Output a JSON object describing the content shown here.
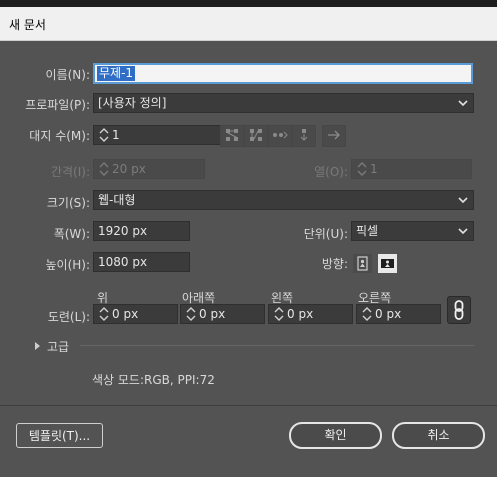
{
  "window": {
    "title": "새 문서"
  },
  "form": {
    "name": {
      "label": "이름(N):",
      "value": "무제-1"
    },
    "profile": {
      "label": "프로파일(P):",
      "value": "[사용자 정의]"
    },
    "artboards": {
      "label": "대지 수(M):",
      "value": "1"
    },
    "spacing": {
      "label": "간격(I):",
      "value": "20 px"
    },
    "columns": {
      "label": "열(O):",
      "value": "1"
    },
    "size": {
      "label": "크기(S):",
      "value": "웹-대형"
    },
    "width": {
      "label": "폭(W):",
      "value": "1920 px"
    },
    "units": {
      "label": "단위(U):",
      "value": "픽셀"
    },
    "height": {
      "label": "높이(H):",
      "value": "1080 px"
    },
    "orientation": {
      "label": "방향:"
    },
    "bleed": {
      "label": "도련(L):",
      "top_label": "위",
      "top_value": "0 px",
      "bottom_label": "아래쪽",
      "bottom_value": "0 px",
      "left_label": "왼쪽",
      "left_value": "0 px",
      "right_label": "오른쪽",
      "right_value": "0 px"
    },
    "advanced": {
      "label": "고급"
    },
    "color_info": "색상 모드:RGB, PPI:72"
  },
  "buttons": {
    "templates": "템플릿(T)...",
    "ok": "확인",
    "cancel": "취소"
  },
  "icons": {
    "arrange": [
      "grid-by-row-icon",
      "grid-by-column-icon",
      "arrange-by-row-icon",
      "arrange-by-column-icon",
      "left-to-right-icon"
    ],
    "orientation": [
      "portrait-icon",
      "landscape-icon"
    ]
  },
  "colors": {
    "dialog_bg": "#535353",
    "field_bg": "#3b3b3b",
    "focus": "#5a9bd6",
    "selection": "#2f6dc7"
  }
}
